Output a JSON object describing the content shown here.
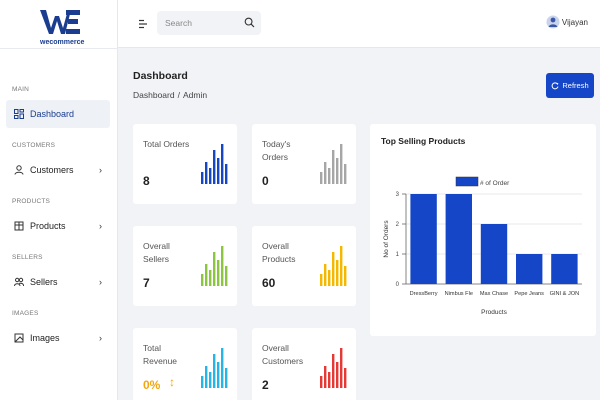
{
  "brand": {
    "logo_text": "wecommerce",
    "primary_color": "#1546c8"
  },
  "header": {
    "menu_icon": "hamburger-icon",
    "search_placeholder": "Search",
    "user_name": "Vijayan"
  },
  "sidebar": {
    "sections": [
      {
        "label": "MAIN",
        "items": [
          {
            "label": "Dashboard",
            "icon": "dashboard-icon",
            "active": true,
            "chevron": false
          }
        ]
      },
      {
        "label": "CUSTOMERS",
        "items": [
          {
            "label": "Customers",
            "icon": "user-icon",
            "active": false,
            "chevron": true
          }
        ]
      },
      {
        "label": "PRODUCTS",
        "items": [
          {
            "label": "Products",
            "icon": "box-icon",
            "active": false,
            "chevron": true
          }
        ]
      },
      {
        "label": "SELLERS",
        "items": [
          {
            "label": "Sellers",
            "icon": "users-icon",
            "active": false,
            "chevron": true
          }
        ]
      },
      {
        "label": "IMAGES",
        "items": [
          {
            "label": "Images",
            "icon": "image-icon",
            "active": false,
            "chevron": true
          }
        ]
      }
    ]
  },
  "page": {
    "title": "Dashboard",
    "breadcrumb": [
      "Dashboard",
      "Admin"
    ],
    "breadcrumb_sep": "/",
    "refresh_label": "Refresh"
  },
  "stats": [
    {
      "label": "Total Orders",
      "value": "8",
      "color": "#1546c8"
    },
    {
      "label": "Today's Orders",
      "value": "0",
      "color": "#a6a6a6"
    },
    {
      "label": "Overall Sellers",
      "value": "7",
      "color": "#8cc63f"
    },
    {
      "label": "Overall Products",
      "value": "60",
      "color": "#f5b800"
    },
    {
      "label": "Total Revenue",
      "value": "0%",
      "extra": "↕",
      "color": "#26b5e8"
    },
    {
      "label": "Overall Customers",
      "value": "2",
      "color": "#e53935"
    }
  ],
  "chart_panel": {
    "title": "Top Selling Products"
  },
  "chart_data": {
    "type": "bar",
    "categories": [
      "DressBerry",
      "Nimbus Fle",
      "Max Chase",
      "Pepe Jeans",
      "GINI & JON"
    ],
    "series": [
      {
        "name": "# of Order",
        "values": [
          3,
          3,
          2,
          1,
          1
        ],
        "color": "#1546c8"
      }
    ],
    "xlabel": "Products",
    "ylabel": "No of Orders",
    "ylim": [
      0,
      3
    ],
    "yticks": [
      "0",
      "1",
      "2",
      "3"
    ],
    "legend_position": "top-center"
  }
}
